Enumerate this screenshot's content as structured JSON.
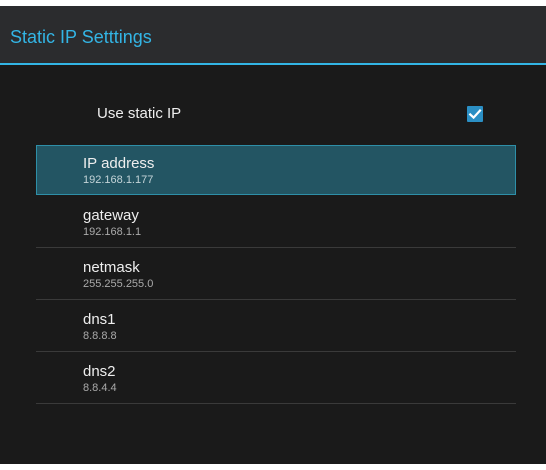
{
  "action_bar": {
    "title": "Static IP Setttings"
  },
  "use_static_ip": {
    "label": "Use static IP",
    "checked": true
  },
  "fields": [
    {
      "title": "IP address",
      "value": "192.168.1.177",
      "selected": true
    },
    {
      "title": "gateway",
      "value": "192.168.1.1",
      "selected": false
    },
    {
      "title": "netmask",
      "value": "255.255.255.0",
      "selected": false
    },
    {
      "title": "dns1",
      "value": "8.8.8.8",
      "selected": false
    },
    {
      "title": "dns2",
      "value": "8.8.4.4",
      "selected": false
    }
  ],
  "colors": {
    "accent": "#33b5e5",
    "background": "#1a1a1a",
    "selected_row": "#235563"
  }
}
